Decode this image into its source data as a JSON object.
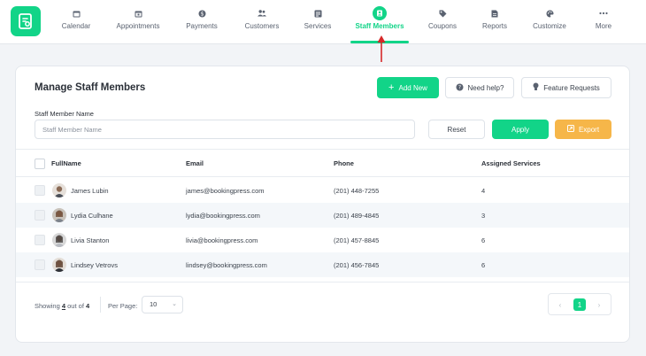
{
  "nav": {
    "items": [
      {
        "label": "Calendar",
        "icon": "calendar-icon"
      },
      {
        "label": "Appointments",
        "icon": "appointments-icon"
      },
      {
        "label": "Payments",
        "icon": "payments-icon"
      },
      {
        "label": "Customers",
        "icon": "customers-icon"
      },
      {
        "label": "Services",
        "icon": "services-icon"
      },
      {
        "label": "Staff Members",
        "icon": "staff-members-icon",
        "active": true
      },
      {
        "label": "Coupons",
        "icon": "coupon-tag-icon"
      },
      {
        "label": "Reports",
        "icon": "reports-icon"
      },
      {
        "label": "Customize",
        "icon": "palette-icon"
      },
      {
        "label": "More",
        "icon": "more-dots-icon"
      }
    ]
  },
  "page": {
    "title": "Manage Staff Members",
    "add_new_label": "Add New",
    "need_help_label": "Need help?",
    "feature_requests_label": "Feature Requests"
  },
  "filter": {
    "label": "Staff Member Name",
    "placeholder": "Staff Member Name",
    "value": "",
    "reset_label": "Reset",
    "apply_label": "Apply",
    "export_label": "Export"
  },
  "table": {
    "headers": {
      "name": "FullName",
      "email": "Email",
      "phone": "Phone",
      "services": "Assigned Services"
    },
    "rows": [
      {
        "name": "James Lubin",
        "email": "james@bookingpress.com",
        "phone": "(201) 448-7255",
        "services": "4"
      },
      {
        "name": "Lydia Culhane",
        "email": "lydia@bookingpress.com",
        "phone": "(201) 489-4845",
        "services": "3"
      },
      {
        "name": "Livia Stanton",
        "email": "livia@bookingpress.com",
        "phone": "(201) 457-8845",
        "services": "6"
      },
      {
        "name": "Lindsey Vetrovs",
        "email": "lindsey@bookingpress.com",
        "phone": "(201) 456-7845",
        "services": "6"
      }
    ]
  },
  "footer": {
    "showing_prefix": "Showing",
    "showing_count": "4",
    "showing_mid": "out of",
    "showing_total": "4",
    "per_page_label": "Per Page:",
    "per_page_value": "10",
    "current_page": "1",
    "prev_symbol": "‹",
    "next_symbol": "›"
  },
  "colors": {
    "accent": "#12d488",
    "export": "#f6b649",
    "annotation_arrow": "#d62828"
  }
}
